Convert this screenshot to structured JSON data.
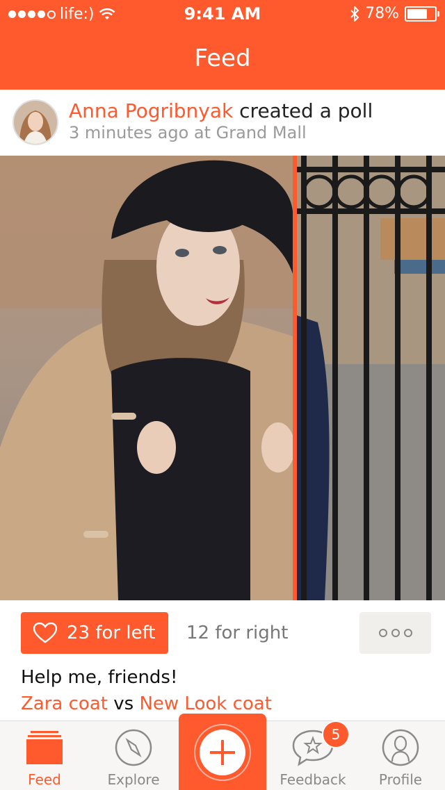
{
  "status_bar": {
    "carrier": "life:)",
    "time": "9:41 AM",
    "battery_percent": "78%",
    "battery_level": 0.78,
    "signal_bars_filled": 4,
    "signal_bars_total": 5
  },
  "nav": {
    "title": "Feed"
  },
  "post": {
    "author": "Anna Pogribnyak",
    "action": "created a poll",
    "meta": "3 minutes ago at Grand Mall",
    "left_votes_label": "23 for left",
    "right_votes_label": "12 for right",
    "caption": "Help me, friends!",
    "left_item": "Zara coat",
    "versus": "vs",
    "right_item": "New Look coat"
  },
  "tabbar": {
    "tabs": [
      {
        "label": "Feed",
        "icon": "feed-icon",
        "active": true
      },
      {
        "label": "Explore",
        "icon": "compass-icon",
        "active": false
      },
      {
        "label": "",
        "icon": "plus-icon",
        "active": false
      },
      {
        "label": "Feedback",
        "icon": "star-bubble-icon",
        "active": false,
        "badge": "5"
      },
      {
        "label": "Profile",
        "icon": "profile-icon",
        "active": false
      }
    ]
  },
  "colors": {
    "accent": "#ff5a2e",
    "tabbar_bg": "#f7f6f4",
    "muted_text": "#9a9a9a"
  }
}
